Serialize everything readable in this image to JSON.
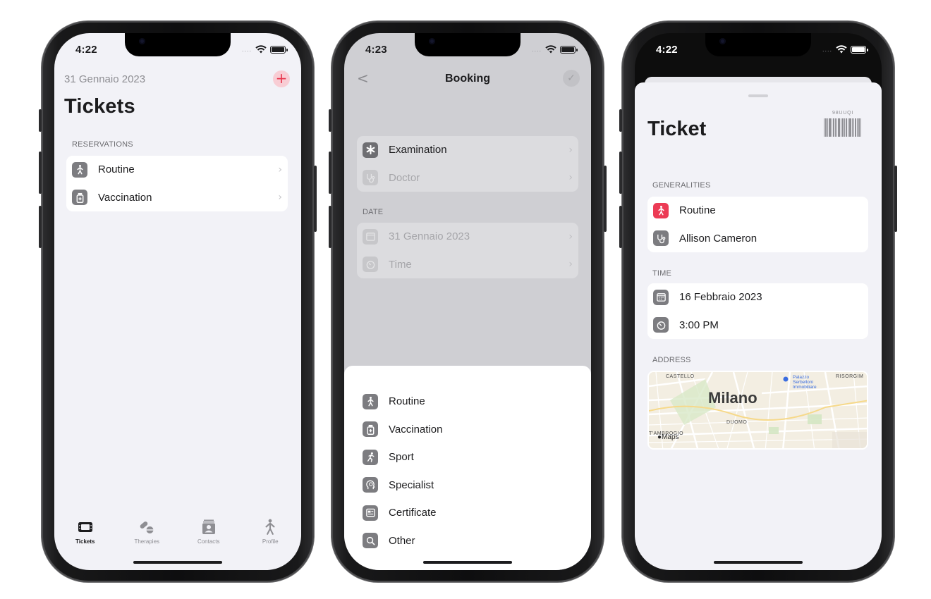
{
  "phone1": {
    "status_time": "4:22",
    "status_signal": "....",
    "date_label": "31 Gennaio 2023",
    "add_symbol": "+",
    "title": "Tickets",
    "section_label": "RESERVATIONS",
    "items": [
      {
        "label": "Routine",
        "icon": "walking-person-icon"
      },
      {
        "label": "Vaccination",
        "icon": "vaccine-bottle-icon"
      }
    ],
    "tabs": [
      {
        "label": "Tickets",
        "icon": "ticket-icon",
        "active": true
      },
      {
        "label": "Therapies",
        "icon": "pills-icon",
        "active": false
      },
      {
        "label": "Contacts",
        "icon": "contacts-card-icon",
        "active": false
      },
      {
        "label": "Profile",
        "icon": "person-icon",
        "active": false
      }
    ]
  },
  "phone2": {
    "status_time": "4:23",
    "status_signal": "....",
    "nav_title": "Booking",
    "back_symbol": "<",
    "check_symbol": "✓",
    "top_items": [
      {
        "label": "Examination",
        "icon": "asterisk-icon"
      },
      {
        "label": "Doctor",
        "icon": "stethoscope-icon"
      }
    ],
    "date_section_label": "DATE",
    "date_items": [
      {
        "label": "31 Gennaio 2023",
        "icon": "calendar-icon"
      },
      {
        "label": "Time",
        "icon": "timer-icon"
      }
    ],
    "sheet_items": [
      {
        "label": "Routine",
        "icon": "walking-person-icon"
      },
      {
        "label": "Vaccination",
        "icon": "vaccine-bottle-icon"
      },
      {
        "label": "Sport",
        "icon": "running-person-icon"
      },
      {
        "label": "Specialist",
        "icon": "brain-head-icon"
      },
      {
        "label": "Certificate",
        "icon": "certificate-icon"
      },
      {
        "label": "Other",
        "icon": "magnifier-icon"
      }
    ]
  },
  "phone3": {
    "status_time": "4:22",
    "status_signal": "....",
    "title": "Ticket",
    "barcode_code": "98UUQI",
    "generalities_label": "GENERALITIES",
    "generalities": [
      {
        "label": "Routine",
        "icon": "walking-person-icon"
      },
      {
        "label": "Allison Cameron",
        "icon": "stethoscope-icon"
      }
    ],
    "time_label": "TIME",
    "time_items": [
      {
        "label": "16 Febbraio 2023",
        "icon": "calendar-icon"
      },
      {
        "label": "3:00 PM",
        "icon": "timer-icon"
      }
    ],
    "address_label": "ADDRESS",
    "map": {
      "city": "Milano",
      "area_castello": "CASTELLO",
      "area_risorgimento": "RISORGIM",
      "area_duomo": "DUOMO",
      "area_ambrogio": "T'AMBROGIO",
      "poi_1": "Palazzo",
      "poi_2": "Serbelloni",
      "poi_3": "Immobiliare",
      "attribution": "Maps"
    }
  },
  "colors": {
    "accent_red": "#ec3b55",
    "icon_gray": "#7c7c80",
    "background": "#f2f2f7"
  }
}
